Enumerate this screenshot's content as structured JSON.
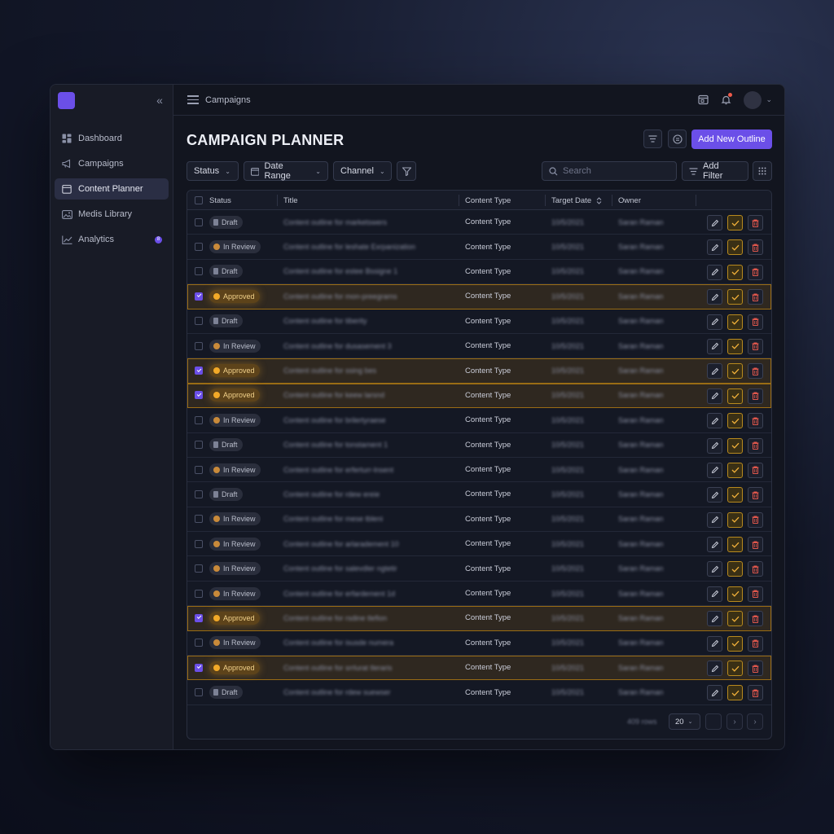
{
  "sidebar": {
    "items": [
      {
        "label": "Dashboard",
        "icon": "dashboard-icon"
      },
      {
        "label": "Campaigns",
        "icon": "megaphone-icon"
      },
      {
        "label": "Content Planner",
        "icon": "calendar-icon",
        "active": true
      },
      {
        "label": "Medis Library",
        "icon": "image-icon"
      },
      {
        "label": "Analytics",
        "icon": "chart-icon",
        "badge": "8"
      }
    ]
  },
  "topbar": {
    "breadcrumb": "Campaigns"
  },
  "header": {
    "title": "CAMPAIGN PLANNER",
    "primary_label": "Add New Outline"
  },
  "filters": {
    "status": "Status",
    "date_range": "Date Range",
    "channel": "Channel",
    "search_placeholder": "Search",
    "add_filter": "Add Filter"
  },
  "table": {
    "columns": [
      "Status",
      "Title",
      "Content Type",
      "Target Date",
      "Owner"
    ],
    "rows": [
      {
        "status": "Draft",
        "title": "Content outline for marketswers",
        "type": "Content Type",
        "date": "10/5/2021",
        "owner": "Saran Raman",
        "checked": false
      },
      {
        "status": "In Review",
        "title": "Content outline for leshate Exrpanization",
        "type": "Content Type",
        "date": "10/5/2021",
        "owner": "Saran Raman",
        "checked": false
      },
      {
        "status": "Draft",
        "title": "Content outline for estee Bssigne 1",
        "type": "Content Type",
        "date": "10/5/2021",
        "owner": "Saran Raman",
        "checked": false
      },
      {
        "status": "Approved",
        "title": "Content outline for mon-preegrams",
        "type": "Content Type",
        "date": "10/5/2021",
        "owner": "Saran Raman",
        "checked": true
      },
      {
        "status": "Draft",
        "title": "Content outline for tiberity",
        "type": "Content Type",
        "date": "10/5/2021",
        "owner": "Saran Raman",
        "checked": false
      },
      {
        "status": "In Review",
        "title": "Content outline for dusasement 3",
        "type": "Content Type",
        "date": "10/5/2021",
        "owner": "Saran Raman",
        "checked": false
      },
      {
        "status": "Approved",
        "title": "Content outline for ssing bes",
        "type": "Content Type",
        "date": "10/5/2021",
        "owner": "Saran Raman",
        "checked": true
      },
      {
        "status": "Approved",
        "title": "Content outline for keew larsnd",
        "type": "Content Type",
        "date": "10/5/2021",
        "owner": "Saran Raman",
        "checked": true
      },
      {
        "status": "In Review",
        "title": "Content outline for brilertyraese",
        "type": "Content Type",
        "date": "10/5/2021",
        "owner": "Saran Raman",
        "checked": false
      },
      {
        "status": "Draft",
        "title": "Content outline for tonstament 1",
        "type": "Content Type",
        "date": "10/5/2021",
        "owner": "Saran Raman",
        "checked": false
      },
      {
        "status": "In Review",
        "title": "Content outline for erferturr-lnsent",
        "type": "Content Type",
        "date": "10/5/2021",
        "owner": "Saran Raman",
        "checked": false
      },
      {
        "status": "Draft",
        "title": "Content outline for rdew ereie",
        "type": "Content Type",
        "date": "10/5/2021",
        "owner": "Saran Raman",
        "checked": false
      },
      {
        "status": "In Review",
        "title": "Content outline for mese tbleni",
        "type": "Content Type",
        "date": "10/5/2021",
        "owner": "Saran Raman",
        "checked": false
      },
      {
        "status": "In Review",
        "title": "Content outline for arlaradement 10",
        "type": "Content Type",
        "date": "10/5/2021",
        "owner": "Saran Raman",
        "checked": false
      },
      {
        "status": "In Review",
        "title": "Content outline for salevdler ngtetir",
        "type": "Content Type",
        "date": "10/5/2021",
        "owner": "Saran Raman",
        "checked": false
      },
      {
        "status": "In Review",
        "title": "Content outline for erfardement 1d",
        "type": "Content Type",
        "date": "10/5/2021",
        "owner": "Saran Raman",
        "checked": false
      },
      {
        "status": "Approved",
        "title": "Content outline for rsdine tlefion",
        "type": "Content Type",
        "date": "10/5/2021",
        "owner": "Saran Raman",
        "checked": true
      },
      {
        "status": "In Review",
        "title": "Content outline for isusde numera",
        "type": "Content Type",
        "date": "10/5/2021",
        "owner": "Saran Raman",
        "checked": false
      },
      {
        "status": "Approved",
        "title": "Content outline for srrlurat tleraris",
        "type": "Content Type",
        "date": "10/5/2021",
        "owner": "Saran Raman",
        "checked": true
      },
      {
        "status": "Draft",
        "title": "Content outline for rdew suewser",
        "type": "Content Type",
        "date": "10/5/2021",
        "owner": "Saran Raman",
        "checked": false
      }
    ]
  },
  "footer": {
    "rows_count": "409 rows",
    "per_page": "20"
  },
  "colors": {
    "accent": "#6b4fe8",
    "approved": "#f2a928",
    "notification": "#ef5a4a"
  }
}
